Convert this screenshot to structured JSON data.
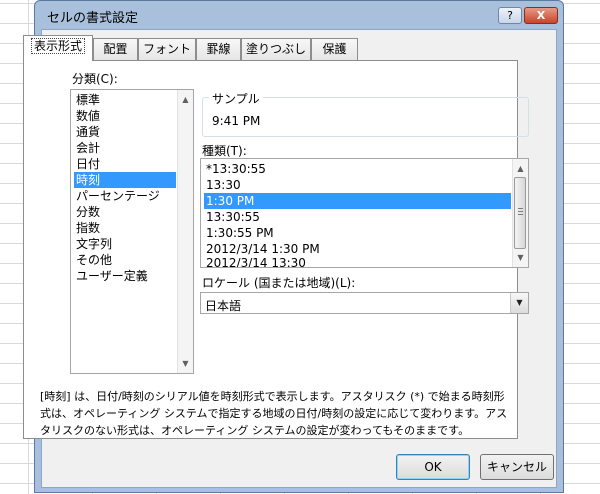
{
  "dialog": {
    "title": "セルの書式設定",
    "help_label": "?",
    "close_label": "X"
  },
  "tabs": [
    "表示形式",
    "配置",
    "フォント",
    "罫線",
    "塗りつぶし",
    "保護"
  ],
  "category": {
    "label": "分類(C):",
    "items": [
      "標準",
      "数値",
      "通貨",
      "会計",
      "日付",
      "時刻",
      "パーセンテージ",
      "分数",
      "指数",
      "文字列",
      "その他",
      "ユーザー定義"
    ],
    "selected": "時刻"
  },
  "sample": {
    "label": "サンプル",
    "value": "9:41 PM"
  },
  "type": {
    "label": "種類(T):",
    "items": [
      "*13:30:55",
      "13:30",
      "1:30 PM",
      "13:30:55",
      "1:30:55 PM",
      "2012/3/14 1:30 PM",
      "2012/3/14 13:30"
    ],
    "selected": "1:30 PM"
  },
  "locale": {
    "label": "ロケール (国または地域)(L):",
    "value": "日本語"
  },
  "description": "[時刻] は、日付/時刻のシリアル値を時刻形式で表示します。アスタリスク (*) で始まる時刻形式は、オペレーティング システムで指定する地域の日付/時刻の設定に応じて変わります。アスタリスクのない形式は、オペレーティング システムの設定が変わってもそのままです。",
  "buttons": {
    "ok": "OK",
    "cancel": "キャンセル"
  },
  "colors": {
    "selection": "#3399ff",
    "title_bar": "#a9c0dc",
    "close_button": "#c7452a"
  }
}
